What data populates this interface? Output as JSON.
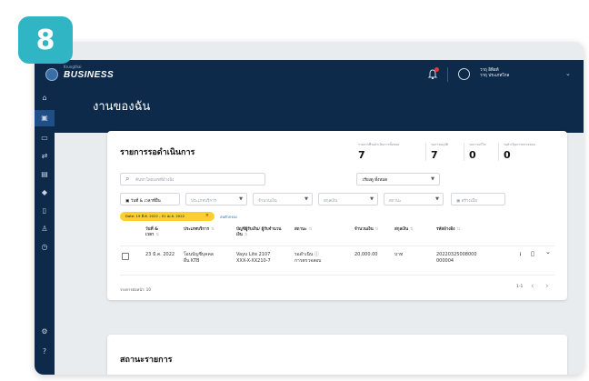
{
  "step_badge": "8",
  "topbar": {
    "logo_small": "Krungthai",
    "logo_text": "BUSINESS",
    "user_line1": "วาฤ อิทิอท์",
    "user_line2": "วาฤ ประเภทโกล"
  },
  "sidebar": {
    "icons": [
      "home-icon",
      "tasks-icon",
      "inbox-icon",
      "transfer-icon",
      "card-icon",
      "tag-icon",
      "document-icon",
      "users-icon",
      "history-icon",
      "settings-icon",
      "help-icon"
    ]
  },
  "hero": {
    "title": "งานของฉัน"
  },
  "pending": {
    "title": "รายการรอดำเนินการ",
    "stats": [
      {
        "label": "รายการที่รอดำเนินการทั้งหมด",
        "value": "7"
      },
      {
        "label": "รอการอนุมัติ",
        "value": "7"
      },
      {
        "label": "รอการแก้ไข",
        "value": "0"
      },
      {
        "label": "รอดำเนินการตรวจสอบ",
        "value": "0"
      }
    ],
    "search_placeholder": "ค้นหาโดยเลขที่อ้างอิง",
    "sort_select": "เรียงดู ทั้งหมด",
    "filters": {
      "date": "วันที่ & เวลาที่ยื่น",
      "service": "ประเภทบริการ",
      "amount": "จำนวนเงิน",
      "currency": "สกุลเงิน",
      "status": "สถานะ",
      "creator": "สร้างเมื่อ"
    },
    "active_chip": "Date: 19 มี.ค. 2022 - 01 เม.ย. 2022",
    "clear_all": "ลบตัวกรอง",
    "columns": {
      "date": "วันที่ & เวลา",
      "service": "ประเภทบริการ",
      "account": "บัญชีผู้รับเงิน/ ผู้รับจำนวนเงิน",
      "status": "สถานะ",
      "amount": "จำนวนเงิน",
      "currency": "สกุลเงิน",
      "reference": "รหัสอ้างอิง"
    },
    "rows": [
      {
        "date": "23 มี.ค. 2022",
        "service_l1": "โอนบัญชีบุคคล",
        "service_l2": "อื่น KTB",
        "account_l1": "Vayu Lite 2107",
        "account_l2": "XXX-X-XX210-7",
        "status_l1": "รอดำเนิน",
        "status_l2": "การตรวจสอบ",
        "amount": "20,000.00",
        "currency": "บาท",
        "reference_l1": "20220325008000",
        "reference_l2": "000004"
      }
    ],
    "page_size": "รายการต่อหน้า: 10",
    "pager_text": "1-1"
  },
  "status_card": {
    "title": "สถานะรายการ"
  },
  "colors": {
    "navy": "#0d2a4a",
    "accent_teal": "#2fb5c4",
    "chip_yellow": "#fbd02e",
    "active_nav": "#1f4f86"
  }
}
